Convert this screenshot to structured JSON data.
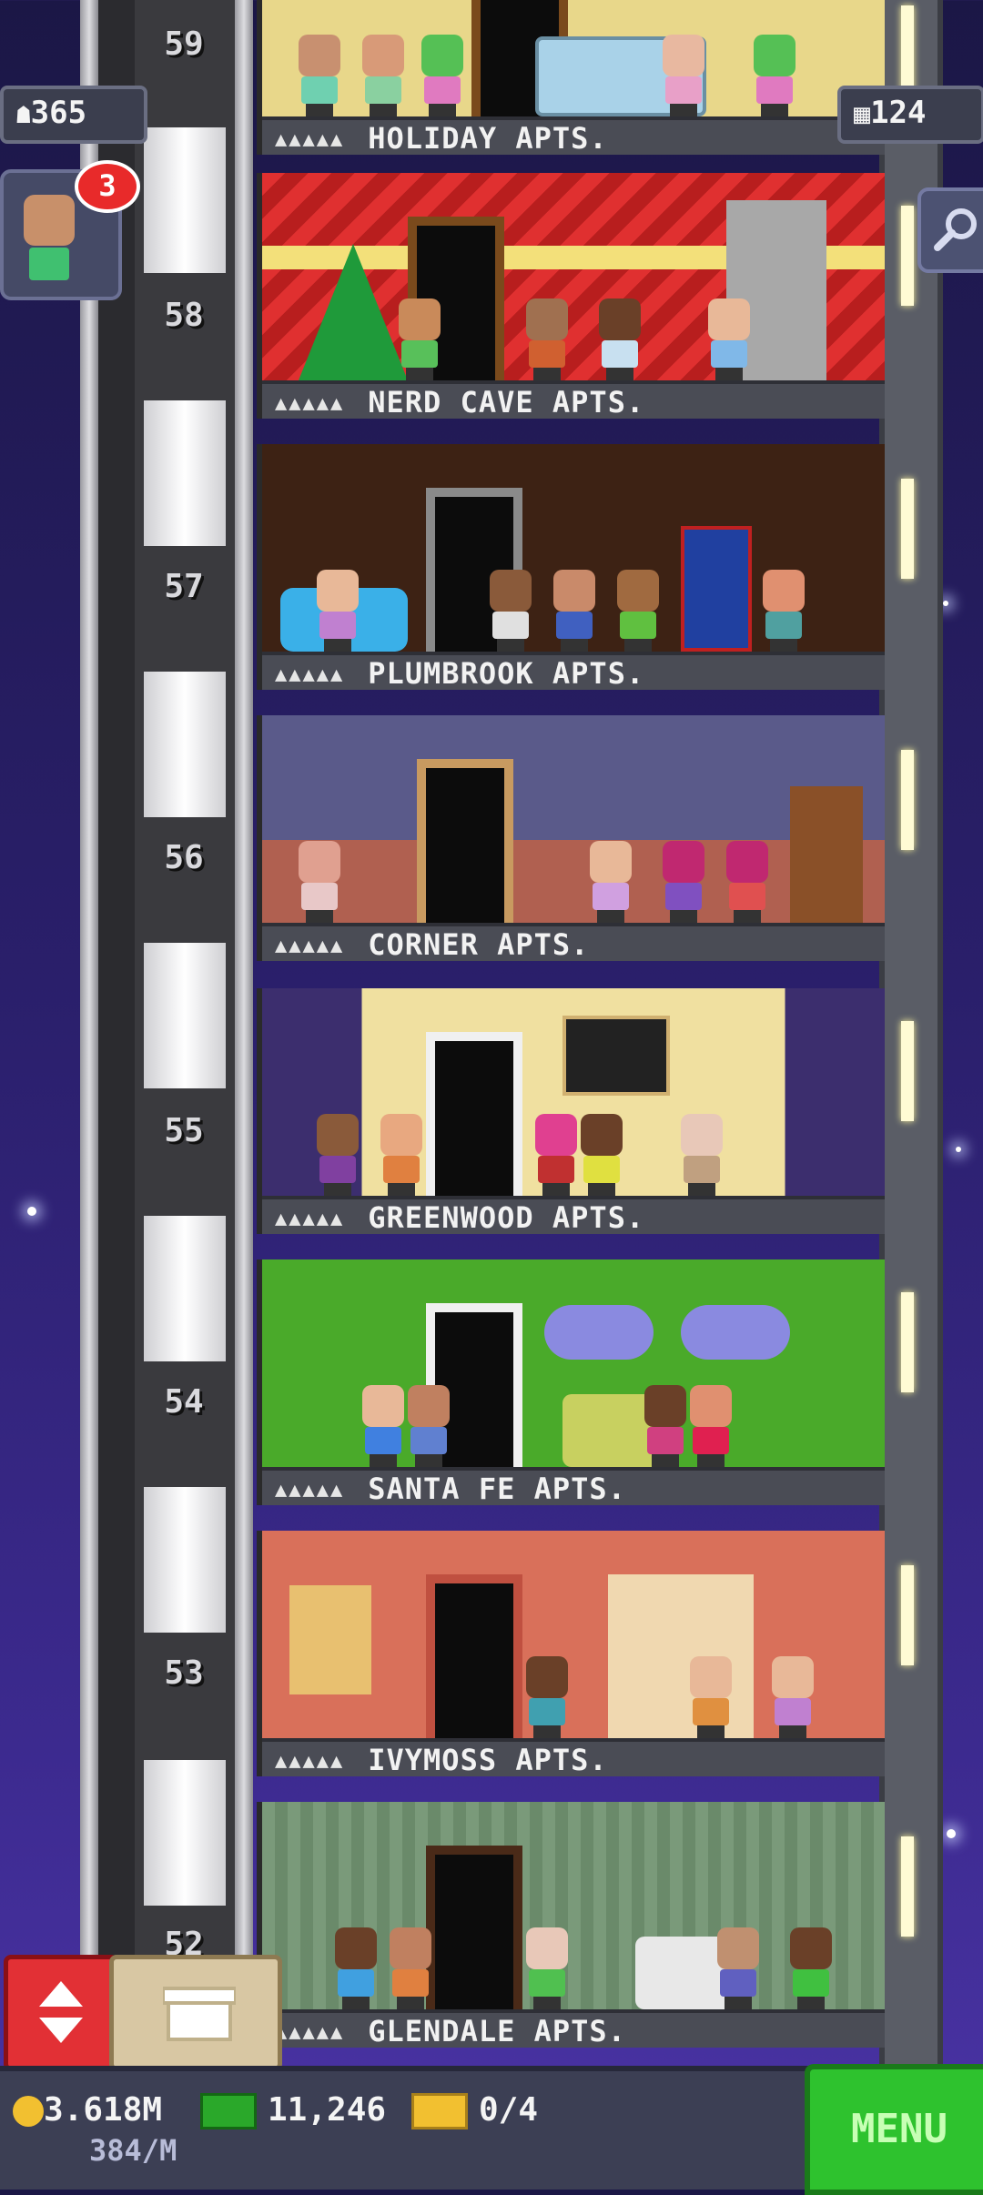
{
  "hud": {
    "population": "365",
    "floor_count": "124",
    "visitor_count": "3"
  },
  "floors": [
    {
      "number": "59",
      "name": "HOLIDAY APTS."
    },
    {
      "number": "58",
      "name": "NERD CAVE APTS."
    },
    {
      "number": "57",
      "name": "PLUMBROOK APTS."
    },
    {
      "number": "56",
      "name": "CORNER APTS."
    },
    {
      "number": "55",
      "name": "GREENWOOD APTS."
    },
    {
      "number": "54",
      "name": "SANTA FE APTS."
    },
    {
      "number": "53",
      "name": "IVYMOSS APTS."
    },
    {
      "number": "52",
      "name": "GLENDALE APTS."
    }
  ],
  "floor_stars": "▲▲▲▲▲",
  "bottom": {
    "coins": "3.618M",
    "coin_rate": "384/M",
    "bux": "11,246",
    "tickets": "0/4",
    "menu_label": "MENU"
  },
  "colors": {
    "menu_green": "#2ec22e",
    "elevator_red": "#e23035",
    "notify_red": "#e82a2a"
  },
  "icons": [
    "person-icon",
    "building-icon",
    "search-icon",
    "elevator-icon",
    "crate-icon",
    "coin-icon",
    "bux-icon",
    "ticket-icon"
  ]
}
